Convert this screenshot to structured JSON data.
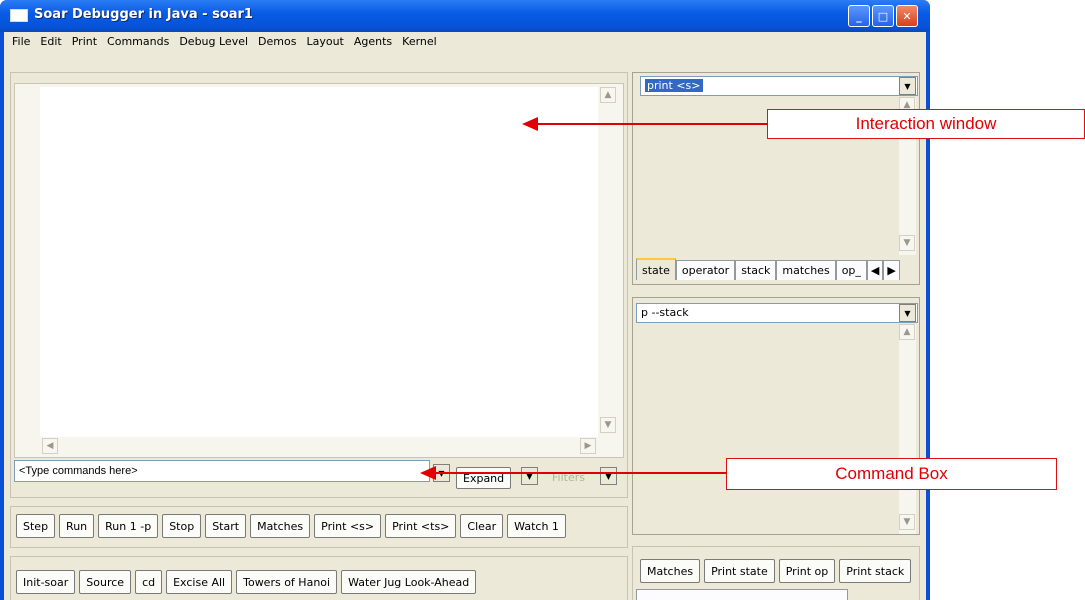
{
  "window": {
    "title": "Soar Debugger in Java - soar1",
    "controls": {
      "minimize": "_",
      "maximize": "□",
      "close": "✕"
    }
  },
  "menu": [
    "File",
    "Edit",
    "Print",
    "Commands",
    "Debug Level",
    "Demos",
    "Layout",
    "Agents",
    "Kernel"
  ],
  "command_box": {
    "value": "<Type commands here>",
    "expand_label": "Expand",
    "filters_label": "Filters"
  },
  "button_row_1": [
    "Step",
    "Run",
    "Run 1 -p",
    "Stop",
    "Start",
    "Matches",
    "Print <s>",
    "Print <ts>",
    "Clear",
    "Watch 1"
  ],
  "button_row_2": [
    "Init-soar",
    "Source",
    "cd",
    "Excise All",
    "Towers of Hanoi",
    "Water Jug Look-Ahead"
  ],
  "right_top": {
    "combo_value": "print <s>",
    "tabs": [
      "state",
      "operator",
      "stack",
      "matches",
      "op_"
    ]
  },
  "right_bottom": {
    "combo_value": "p --stack"
  },
  "right_buttons": [
    "Matches",
    "Print state",
    "Print op",
    "Print stack"
  ],
  "annotations": {
    "interaction": "Interaction window",
    "command": "Command Box"
  },
  "colors": {
    "titlebar": "#0a5ce6",
    "client": "#ece9d8",
    "selection": "#316ac5",
    "annotation": "#e00000"
  }
}
